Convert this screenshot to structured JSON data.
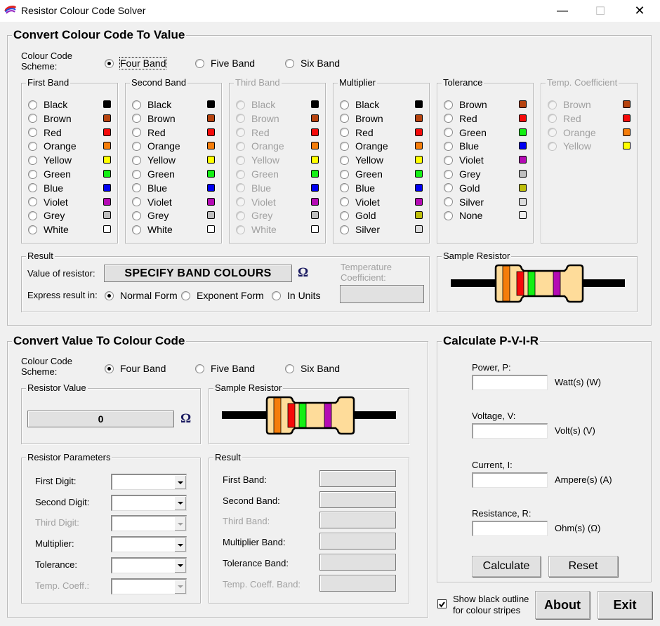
{
  "window": {
    "title": "Resistor Colour Code Solver",
    "icon": "rainbow-app-icon",
    "controls": {
      "minimize": "—",
      "maximize": "☐",
      "close": "✕"
    }
  },
  "colour_to_value": {
    "title": "Convert Colour Code To Value",
    "scheme_label": "Colour Code Scheme:",
    "schemes": [
      {
        "label": "Four Band",
        "selected": true
      },
      {
        "label": "Five Band",
        "selected": false
      },
      {
        "label": "Six Band",
        "selected": false
      }
    ],
    "band_groups": [
      {
        "title": "First Band",
        "enabled": true,
        "options": [
          {
            "label": "Black",
            "color": "#000000"
          },
          {
            "label": "Brown",
            "color": "#b6430f"
          },
          {
            "label": "Red",
            "color": "#f50a0a"
          },
          {
            "label": "Orange",
            "color": "#f57d0a"
          },
          {
            "label": "Yellow",
            "color": "#ffff00"
          },
          {
            "label": "Green",
            "color": "#14f014"
          },
          {
            "label": "Blue",
            "color": "#0000f0"
          },
          {
            "label": "Violet",
            "color": "#b40ab4"
          },
          {
            "label": "Grey",
            "color": "#bebebe"
          },
          {
            "label": "White",
            "color": "#ffffff"
          }
        ]
      },
      {
        "title": "Second Band",
        "enabled": true,
        "options": [
          {
            "label": "Black",
            "color": "#000000"
          },
          {
            "label": "Brown",
            "color": "#b6430f"
          },
          {
            "label": "Red",
            "color": "#f50a0a"
          },
          {
            "label": "Orange",
            "color": "#f57d0a"
          },
          {
            "label": "Yellow",
            "color": "#ffff00"
          },
          {
            "label": "Green",
            "color": "#14f014"
          },
          {
            "label": "Blue",
            "color": "#0000f0"
          },
          {
            "label": "Violet",
            "color": "#b40ab4"
          },
          {
            "label": "Grey",
            "color": "#bebebe"
          },
          {
            "label": "White",
            "color": "#ffffff"
          }
        ]
      },
      {
        "title": "Third Band",
        "enabled": false,
        "options": [
          {
            "label": "Black",
            "color": "#000000"
          },
          {
            "label": "Brown",
            "color": "#b6430f"
          },
          {
            "label": "Red",
            "color": "#f50a0a"
          },
          {
            "label": "Orange",
            "color": "#f57d0a"
          },
          {
            "label": "Yellow",
            "color": "#ffff00"
          },
          {
            "label": "Green",
            "color": "#14f014"
          },
          {
            "label": "Blue",
            "color": "#0000f0"
          },
          {
            "label": "Violet",
            "color": "#b40ab4"
          },
          {
            "label": "Grey",
            "color": "#bebebe"
          },
          {
            "label": "White",
            "color": "#ffffff"
          }
        ]
      },
      {
        "title": "Multiplier",
        "enabled": true,
        "options": [
          {
            "label": "Black",
            "color": "#000000"
          },
          {
            "label": "Brown",
            "color": "#b6430f"
          },
          {
            "label": "Red",
            "color": "#f50a0a"
          },
          {
            "label": "Orange",
            "color": "#f57d0a"
          },
          {
            "label": "Yellow",
            "color": "#ffff00"
          },
          {
            "label": "Green",
            "color": "#14f014"
          },
          {
            "label": "Blue",
            "color": "#0000f0"
          },
          {
            "label": "Violet",
            "color": "#b40ab4"
          },
          {
            "label": "Gold",
            "color": "#bebe0a"
          },
          {
            "label": "Silver",
            "color": "#dcdcdc"
          }
        ]
      },
      {
        "title": "Tolerance",
        "enabled": true,
        "options": [
          {
            "label": "Brown",
            "color": "#b6430f"
          },
          {
            "label": "Red",
            "color": "#f50a0a"
          },
          {
            "label": "Green",
            "color": "#14f014"
          },
          {
            "label": "Blue",
            "color": "#0000f0"
          },
          {
            "label": "Violet",
            "color": "#b40ab4"
          },
          {
            "label": "Grey",
            "color": "#bebebe"
          },
          {
            "label": "Gold",
            "color": "#bebe0a"
          },
          {
            "label": "Silver",
            "color": "#dcdcdc"
          },
          {
            "label": "None",
            "color": "#f0f0f0"
          }
        ]
      },
      {
        "title": "Temp. Coefficient",
        "enabled": false,
        "options": [
          {
            "label": "Brown",
            "color": "#b6430f"
          },
          {
            "label": "Red",
            "color": "#f50a0a"
          },
          {
            "label": "Orange",
            "color": "#f57d0a"
          },
          {
            "label": "Yellow",
            "color": "#ffff00"
          }
        ]
      }
    ],
    "result": {
      "title": "Result",
      "value_label": "Value of resistor:",
      "value": "SPECIFY BAND COLOURS",
      "unit": "Ω",
      "express_label": "Express result in:",
      "forms": [
        {
          "label": "Normal Form",
          "selected": true
        },
        {
          "label": "Exponent Form",
          "selected": false
        },
        {
          "label": "In Units",
          "selected": false
        }
      ],
      "temp_coeff_label": "Temperature Coefficient:",
      "temp_coeff_value": ""
    },
    "sample_resistor": {
      "title": "Sample Resistor",
      "bands": [
        "#f57d0a",
        "#f50a0a",
        "#14f014",
        "#b40ab4"
      ]
    }
  },
  "value_to_colour": {
    "title": "Convert Value To Colour Code",
    "scheme_label": "Colour Code Scheme:",
    "schemes": [
      {
        "label": "Four Band",
        "selected": true
      },
      {
        "label": "Five Band",
        "selected": false
      },
      {
        "label": "Six Band",
        "selected": false
      }
    ],
    "resistor_value": {
      "title": "Resistor Value",
      "value": "0",
      "unit": "Ω"
    },
    "sample_resistor": {
      "title": "Sample Resistor",
      "bands": [
        "#f57d0a",
        "#f50a0a",
        "#14f014",
        "#b40ab4"
      ]
    },
    "parameters": {
      "title": "Resistor Parameters",
      "fields": [
        {
          "label": "First Digit:",
          "value": "",
          "enabled": true
        },
        {
          "label": "Second Digit:",
          "value": "",
          "enabled": true
        },
        {
          "label": "Third Digit:",
          "value": "",
          "enabled": false
        },
        {
          "label": "Multiplier:",
          "value": "",
          "enabled": true
        },
        {
          "label": "Tolerance:",
          "value": "",
          "enabled": true
        },
        {
          "label": "Temp. Coeff.:",
          "value": "",
          "enabled": false
        }
      ]
    },
    "result": {
      "title": "Result",
      "fields": [
        {
          "label": "First Band:",
          "value": "",
          "enabled": true
        },
        {
          "label": "Second Band:",
          "value": "",
          "enabled": true
        },
        {
          "label": "Third Band:",
          "value": "",
          "enabled": false
        },
        {
          "label": "Multiplier Band:",
          "value": "",
          "enabled": true
        },
        {
          "label": "Tolerance Band:",
          "value": "",
          "enabled": true
        },
        {
          "label": "Temp. Coeff. Band:",
          "value": "",
          "enabled": false
        }
      ]
    }
  },
  "pvir": {
    "title": "Calculate P-V-I-R",
    "fields": [
      {
        "label": "Power, P:",
        "unit": "Watt(s) (W)",
        "value": ""
      },
      {
        "label": "Voltage, V:",
        "unit": "Volt(s) (V)",
        "value": ""
      },
      {
        "label": "Current, I:",
        "unit": "Ampere(s) (A)",
        "value": ""
      },
      {
        "label": "Resistance, R:",
        "unit": "Ohm(s) (Ω)",
        "value": ""
      }
    ],
    "calculate_label": "Calculate",
    "reset_label": "Reset"
  },
  "footer": {
    "outline_checkbox_label": "Show black outline for colour stripes",
    "outline_checked": true,
    "about_label": "About",
    "exit_label": "Exit"
  }
}
